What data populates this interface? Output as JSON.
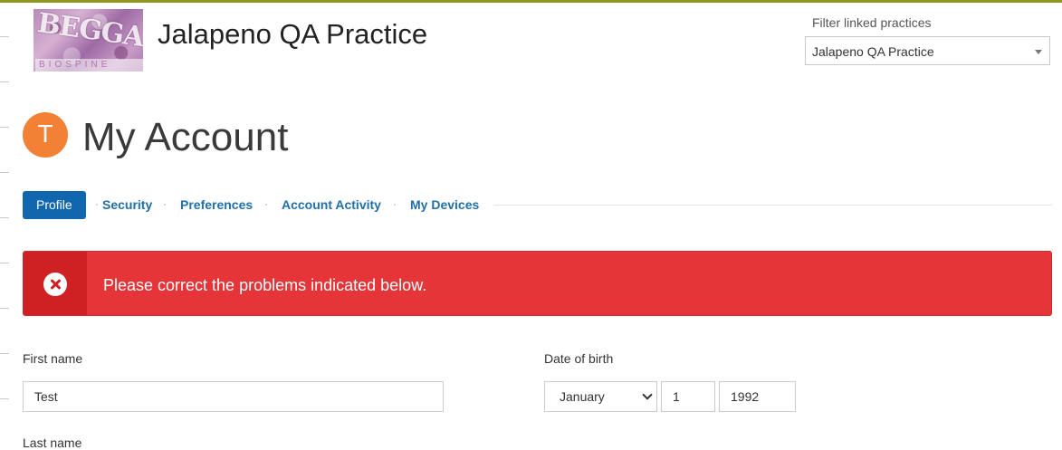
{
  "header": {
    "practice_name": "Jalapeno QA Practice",
    "logo_icon": "practice-logo-image",
    "logo_text": "BEGGA",
    "logo_subtext": "BIOSPINE"
  },
  "filter": {
    "label": "Filter linked practices",
    "selected": "Jalapeno QA Practice"
  },
  "account": {
    "avatar_initial": "T",
    "avatar_color": "#f28035",
    "title": "My Account"
  },
  "tabs": [
    {
      "label": "Profile",
      "active": true
    },
    {
      "label": "Security",
      "active": false
    },
    {
      "label": "Preferences",
      "active": false
    },
    {
      "label": "Account Activity",
      "active": false
    },
    {
      "label": "My Devices",
      "active": false
    }
  ],
  "alert": {
    "icon": "error-x-icon",
    "message": "Please correct the problems indicated below.",
    "color": "#e63538"
  },
  "form": {
    "first_name_label": "First name",
    "first_name_value": "Test",
    "last_name_label": "Last name",
    "dob_label": "Date of birth",
    "dob_month": "January",
    "dob_day": "1",
    "dob_year": "1992"
  },
  "colors": {
    "accent": "#1167ad",
    "link": "#1f6fab"
  }
}
